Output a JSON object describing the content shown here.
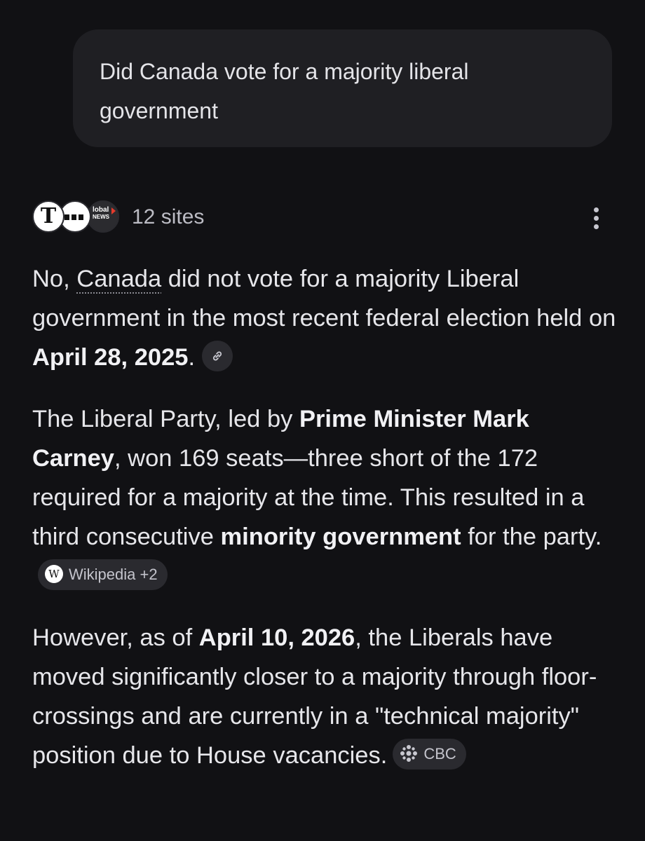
{
  "user_message": {
    "text": "Did Canada vote for a majority liberal government"
  },
  "sources": {
    "logos": [
      "T",
      "globalnews"
    ],
    "global_top": "lobal",
    "global_bottom": "NEWS",
    "count_label": "12 sites"
  },
  "answer": {
    "p1": {
      "pre": "No, ",
      "link": "Canada",
      "mid": " did not vote for a majority Liberal government in the most recent federal election held on ",
      "bold": "April 28, 2025",
      "post": "."
    },
    "p2": {
      "t1": "The Liberal Party, led by ",
      "b1": "Prime Minister Mark Carney",
      "t2": ", won 169 seats—three short of the 172 required for a majority at the time. This resulted in a third consecutive ",
      "b2": "minority government",
      "t3": " for the party.",
      "citation_icon": "W",
      "citation": "Wikipedia +2"
    },
    "p3": {
      "t1": "However, as of ",
      "b1": "April 10, 2026",
      "t2": ", the Liberals have moved significantly closer to a majority through floor-crossings and are currently in a \"technical majority\" position due to House vacancies.",
      "citation": "CBC"
    }
  },
  "icons": {
    "link": "link-icon",
    "more": "more-vert-icon",
    "cbc": "cbc-gem-icon"
  }
}
